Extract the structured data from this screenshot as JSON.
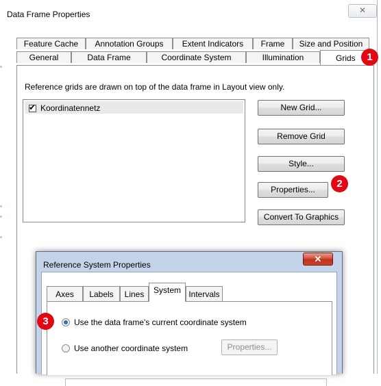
{
  "main_dialog": {
    "title": "Data Frame Properties",
    "close_glyph": "✕"
  },
  "tabs_row1": [
    "Feature Cache",
    "Annotation Groups",
    "Extent Indicators",
    "Frame",
    "Size and Position"
  ],
  "tabs_row2": [
    "General",
    "Data Frame",
    "Coordinate System",
    "Illumination",
    "Grids"
  ],
  "active_tab": "Grids",
  "grids": {
    "description": "Reference grids are drawn on top of the data frame in Layout view only.",
    "list_items": [
      {
        "label": "Koordinatennetz",
        "checked": true
      }
    ],
    "buttons": {
      "new_grid": "New Grid...",
      "remove_grid": "Remove Grid",
      "style": "Style...",
      "properties": "Properties...",
      "convert": "Convert To Graphics"
    }
  },
  "badges": [
    "1",
    "2",
    "3"
  ],
  "sub_dialog": {
    "title": "Reference System Properties",
    "close_glyph": "✕",
    "tabs": [
      "Axes",
      "Labels",
      "Lines",
      "System",
      "Intervals"
    ],
    "active_tab": "System",
    "options": [
      {
        "label": "Use the data frame's current coordinate system",
        "selected": true
      },
      {
        "label": "Use another coordinate system",
        "selected": false
      }
    ],
    "properties_button": "Properties..."
  },
  "colors": {
    "badge": "#e30613",
    "sub_title_bar": "#c4d3e7",
    "close_red": "#c0311c"
  }
}
